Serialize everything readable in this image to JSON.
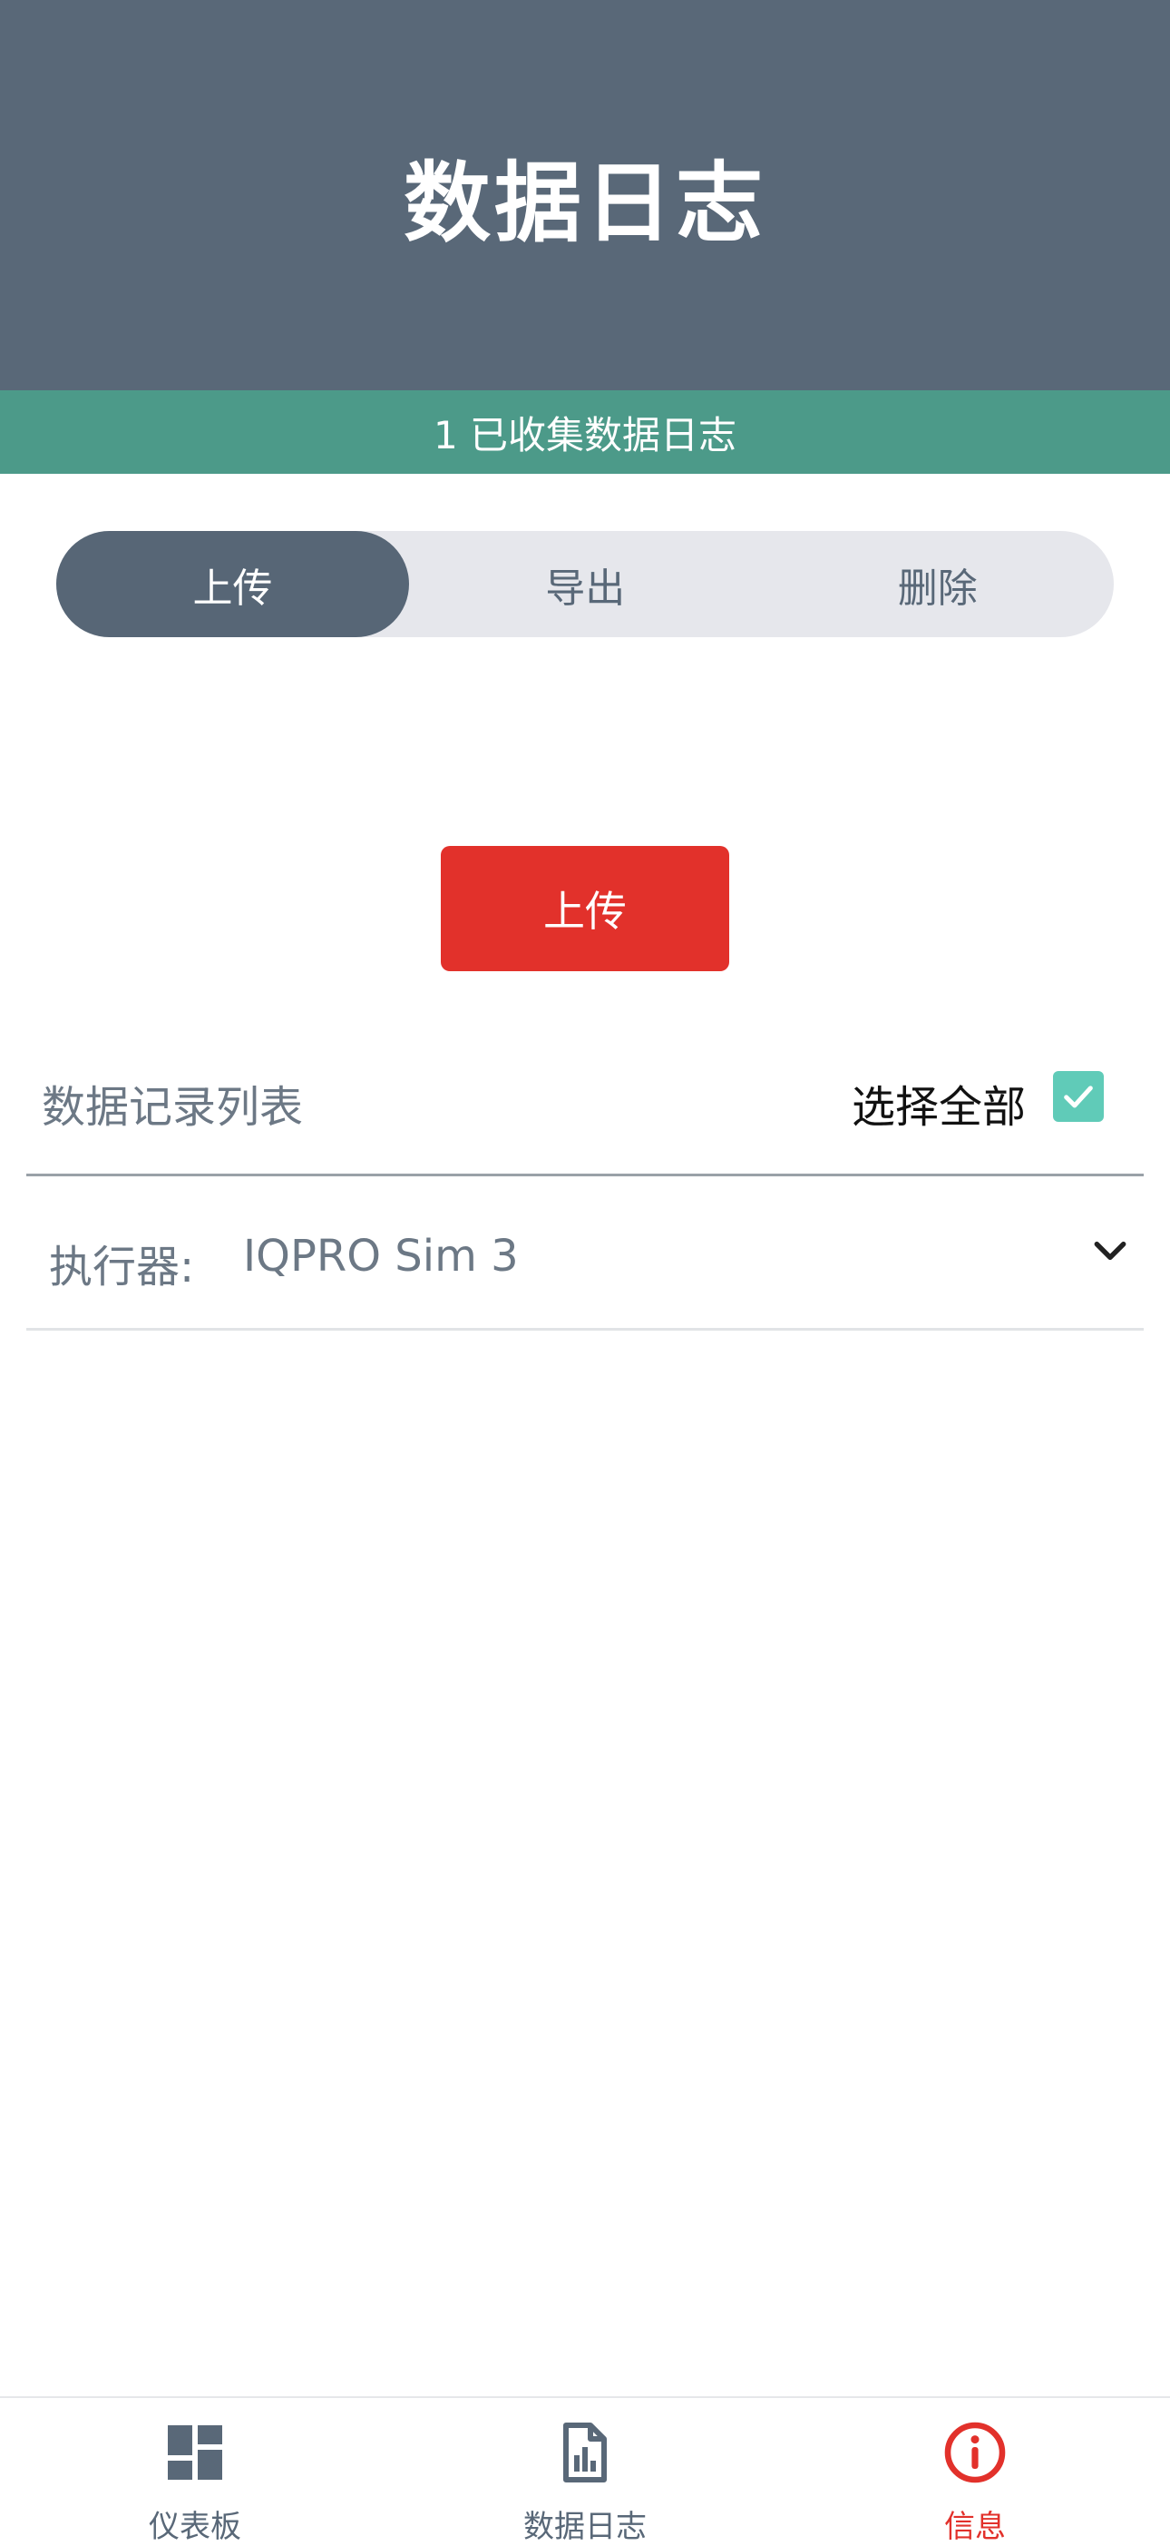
{
  "header": {
    "title": "数据日志"
  },
  "status": {
    "text": "1 已收集数据日志"
  },
  "segmented": {
    "tabs": [
      {
        "label": "上传",
        "active": true
      },
      {
        "label": "导出",
        "active": false
      },
      {
        "label": "删除",
        "active": false
      }
    ]
  },
  "actions": {
    "upload_label": "上传"
  },
  "list": {
    "title": "数据记录列表",
    "select_all_label": "选择全部",
    "select_all_checked": true,
    "rows": [
      {
        "label": "执行器:",
        "value": "IQPRO Sim 3"
      }
    ]
  },
  "bottom_nav": {
    "items": [
      {
        "label": "仪表板",
        "icon": "dashboard-icon",
        "active": false
      },
      {
        "label": "数据日志",
        "icon": "report-icon",
        "active": false
      },
      {
        "label": "信息",
        "icon": "info-icon",
        "active": true
      }
    ]
  },
  "colors": {
    "header_bg": "#596878",
    "status_bg": "#4c9a89",
    "accent_red": "#e2312b",
    "checkbox_teal": "#60cbb8"
  }
}
